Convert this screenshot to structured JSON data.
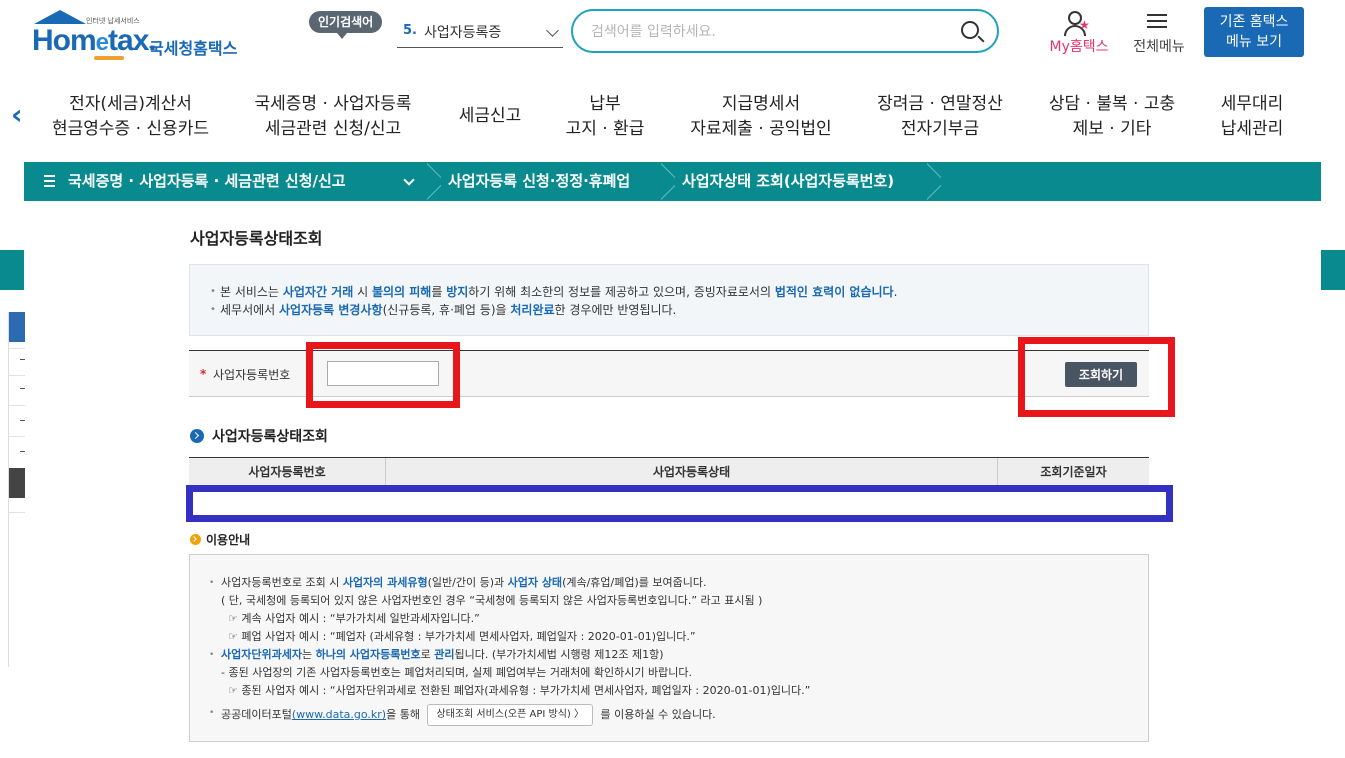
{
  "header": {
    "logo_tagline": "인터넷 납세서비스",
    "logo_word_pre": "Hom",
    "logo_word_e": "e",
    "logo_word_post": "tax.",
    "logo_kor": "국세청홈택스",
    "hot_label": "인기검색어",
    "hot_num": "5.",
    "hot_text": "사업자등록증",
    "search_placeholder": "검색어를 입력하세요.",
    "my_label": "My홈택스",
    "allmenu_label": "전체메뉴",
    "oldmenu_line1": "기존 홈택스",
    "oldmenu_line2": "메뉴 보기"
  },
  "gnb": [
    {
      "line1": "전자(세금)계산서",
      "line2": "현금영수증 · 신용카드"
    },
    {
      "line1": "국세증명 · 사업자등록",
      "line2": "세금관련 신청/신고"
    },
    {
      "line1": "세금신고",
      "line2": ""
    },
    {
      "line1": "납부",
      "line2": "고지 · 환급"
    },
    {
      "line1": "지급명세서",
      "line2": "자료제출 · 공익법인"
    },
    {
      "line1": "장려금 · 연말정산",
      "line2": "전자기부금"
    },
    {
      "line1": "상담 · 불복 · 고충",
      "line2": "제보 · 기타"
    },
    {
      "line1": "세무대리",
      "line2": "납세관리"
    }
  ],
  "breadcrumb": {
    "level1": "국세증명 · 사업자등록 · 세금관련 신청/신고",
    "level2": "사업자등록 신청·정정·휴폐업",
    "level3": "사업자상태 조회(사업자등록번호)"
  },
  "page_title": "사업자등록상태조회",
  "notice": {
    "l1": {
      "a": "본 서비스는 ",
      "b": "사업자간 거래",
      "c": " 시 ",
      "d": "불의의 피해",
      "e": "를 ",
      "f": "방지",
      "g": "하기 위해 최소한의 정보를 제공하고 있으며, 증빙자료로서의 ",
      "h": "법적인 효력이 없습니다",
      "i": "."
    },
    "l2": {
      "a": "세무서에서 ",
      "b": "사업자등록 변경사항",
      "c": "(신규등록, 휴·폐업 등)을 ",
      "d": "처리완료",
      "e": "한 경우에만 반영됩니다."
    }
  },
  "form": {
    "required_mark": "*",
    "label": "사업자등록번호",
    "value": "",
    "button": "조회하기"
  },
  "result": {
    "title": "사업자등록상태조회",
    "col1": "사업자등록번호",
    "col2": "사업자등록상태",
    "col3": "조회기준일자"
  },
  "guide": {
    "title": "이용안내",
    "r1": {
      "a": "사업자등록번호로 조회 시 ",
      "b": "사업자의 과세유형",
      "c": "(일반/간이 등)과 ",
      "d": "사업자 상태",
      "e": "(계속/휴업/폐업)를 보여줍니다."
    },
    "r2": "( 단, 국세청에 등록되어 있지 않은 사업자번호인 경우 “국세청에 등록되지 않은 사업자등록번호입니다.” 라고 표시됨 )",
    "r3": "☞ 계속 사업자 예시 : “부가가치세 일반과세자입니다.”",
    "r4": "☞ 폐업 사업자 예시 : “폐업자 (과세유형 : 부가가치세 면세사업자, 폐업일자 : 2020-01-01)입니다.”",
    "r5": {
      "a": "사업자단위과세자",
      "b": "는 ",
      "c": "하나의 사업자등록번호",
      "d": "로 ",
      "e": "관리",
      "f": "됩니다. (부가가치세법 시행령 제12조 제1항)"
    },
    "r6": "- 종된 사업장의 기존 사업자등록번호는 폐업처리되며, 실제 폐업여부는 거래처에 확인하시기 바랍니다.",
    "r7": "☞ 종된 사업자 예시 : “사업자단위과세로 전환된 폐업자(과세유형 : 부가가치세 면세사업자, 폐업일자 : 2020-01-01)입니다.”",
    "r8": {
      "a": "공공데이터포털",
      "link": "(www.data.go.kr)",
      "b": "을 통해 ",
      "btn": "상태조회 서비스(오픈 API 방식)  〉",
      "c": " 를 이용하실 수 있습니다."
    }
  },
  "colors": {
    "brand_blue": "#1a69b4",
    "teal": "#098a8e",
    "highlight_red": "#e8151b",
    "highlight_blue": "#3431c2"
  }
}
